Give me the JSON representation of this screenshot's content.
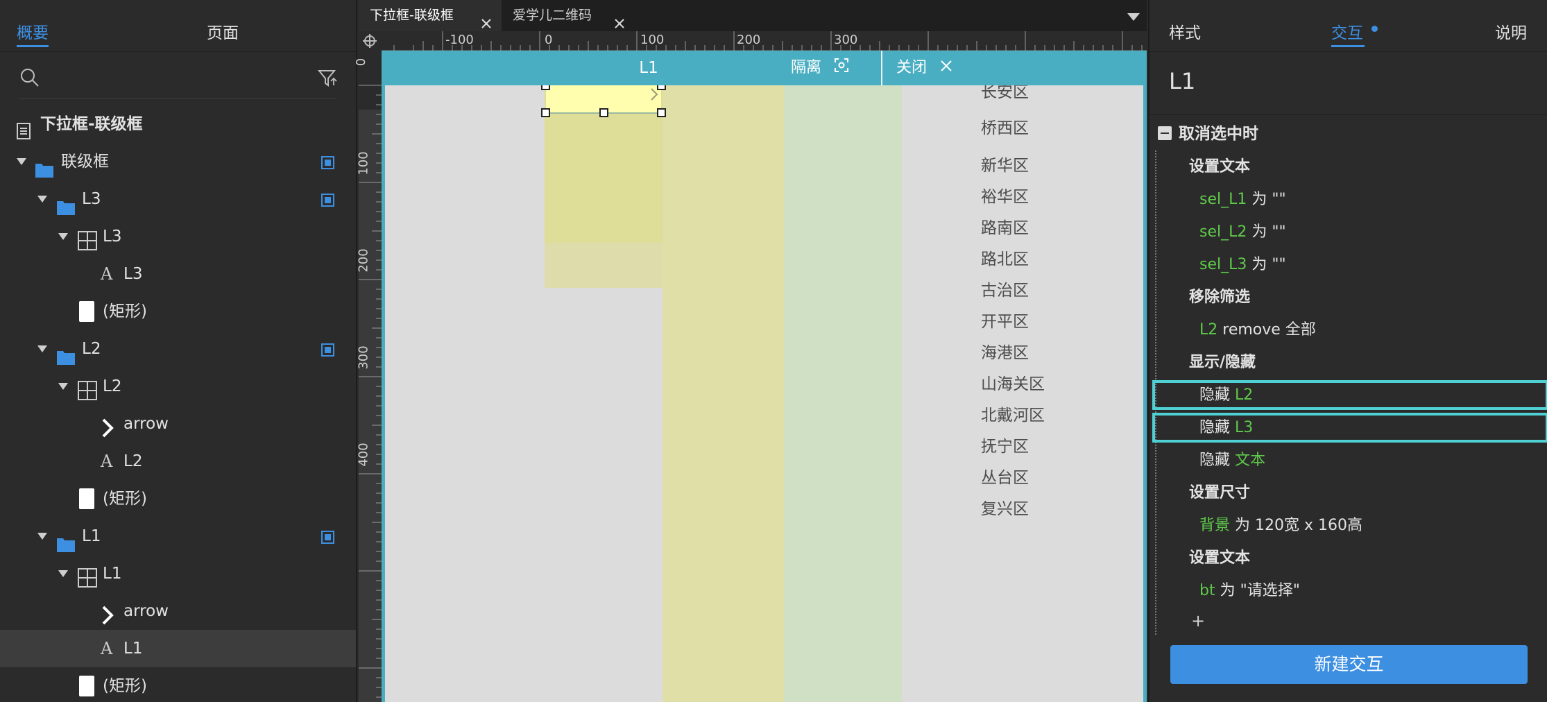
{
  "left_panel": {
    "tabs": [
      "概要",
      "页面"
    ],
    "tree": [
      {
        "label": "下拉框-联级框",
        "icon": "page-icon"
      },
      {
        "label": "联级框",
        "icon": "folder-icon"
      },
      {
        "label": "L3",
        "icon": "folder-icon"
      },
      {
        "label": "L3",
        "icon": "repeater-icon"
      },
      {
        "label": "L3",
        "icon": "text-icon"
      },
      {
        "label": "(矩形)",
        "icon": "rectangle-icon"
      },
      {
        "label": "L2",
        "icon": "folder-icon"
      },
      {
        "label": "L2",
        "icon": "repeater-icon"
      },
      {
        "label": "arrow",
        "icon": "chevron-right-icon"
      },
      {
        "label": "L2",
        "icon": "text-icon"
      },
      {
        "label": "(矩形)",
        "icon": "rectangle-icon"
      },
      {
        "label": "L1",
        "icon": "folder-icon"
      },
      {
        "label": "L1",
        "icon": "repeater-icon"
      },
      {
        "label": "arrow",
        "icon": "chevron-right-icon"
      },
      {
        "label": "L1",
        "icon": "text-icon"
      },
      {
        "label": "(矩形)",
        "icon": "rectangle-icon"
      }
    ]
  },
  "doc_tabs": [
    "下拉框-联级框",
    "爱学儿二维码"
  ],
  "ruler": {
    "h_labels": [
      "-100",
      "0",
      "100",
      "200",
      "300"
    ],
    "v_labels": [
      "0",
      "100",
      "200",
      "300",
      "400"
    ]
  },
  "canvas": {
    "frame_title": "L1",
    "isolate_label": "隔离",
    "close_label": "关闭",
    "district_list": [
      "长安区",
      "桥西区",
      "新华区",
      "裕华区",
      "路南区",
      "路北区",
      "古治区",
      "开平区",
      "海港区",
      "山海关区",
      "北戴河区",
      "抚宁区",
      "丛台区",
      "复兴区"
    ]
  },
  "right_panel": {
    "tabs": [
      "样式",
      "交互",
      "说明"
    ],
    "element_name": "L1",
    "event": "取消选中时",
    "actions": [
      {
        "action": "设置文本",
        "targets": [
          {
            "name": "sel_L1",
            "text": " 为 \"\""
          },
          {
            "name": "sel_L2",
            "text": " 为 \"\""
          },
          {
            "name": "sel_L3",
            "text": " 为 \"\""
          }
        ]
      },
      {
        "action": "移除筛选",
        "targets": [
          {
            "name": "L2",
            "text": " remove 全部"
          }
        ]
      },
      {
        "action": "显示/隐藏",
        "targets": [
          {
            "prefix": "隐藏 ",
            "name": "L2",
            "highlight": true
          },
          {
            "prefix": "隐藏 ",
            "name": "L3",
            "highlight": true
          },
          {
            "prefix": "隐藏 ",
            "name": "文本"
          }
        ]
      },
      {
        "action": "设置尺寸",
        "targets": [
          {
            "name": "背景",
            "text": " 为 120宽 x 160高"
          }
        ]
      },
      {
        "action": "设置文本",
        "targets": [
          {
            "name": "bt",
            "text": " 为 \"请选择\""
          }
        ]
      }
    ],
    "add_symbol": "+",
    "new_button": "新建交互"
  },
  "colors": {
    "accent": "#3d8fe2",
    "frame": "#4aaec3",
    "highlight": "#4fd0d3",
    "target_green": "#5fc94a"
  }
}
